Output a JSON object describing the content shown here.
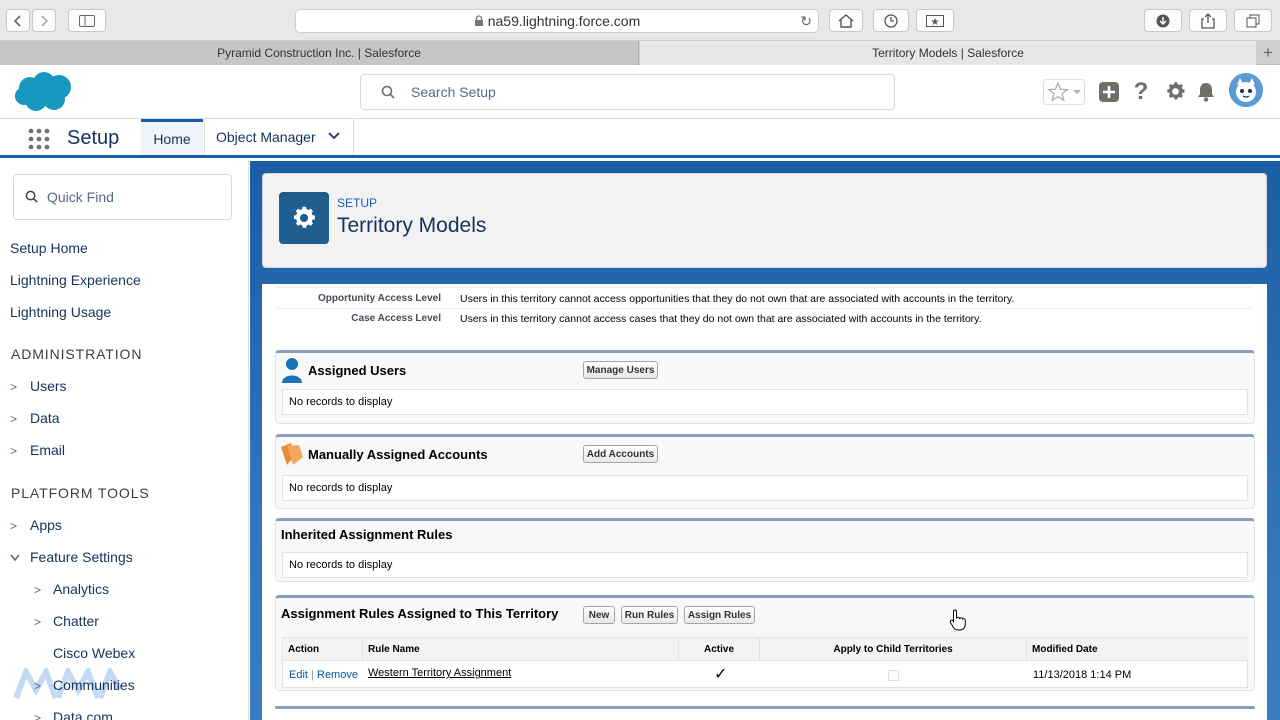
{
  "browser": {
    "url": "na59.lightning.force.com",
    "tabs": [
      {
        "label": "Pyramid Construction Inc. | Salesforce"
      },
      {
        "label": "Territory Models | Salesforce"
      }
    ]
  },
  "header": {
    "search_placeholder": "Search Setup"
  },
  "nav": {
    "app_name": "Setup",
    "home": "Home",
    "object_manager": "Object Manager"
  },
  "sidebar": {
    "quick_find_placeholder": "Quick Find",
    "top_links": [
      "Setup Home",
      "Lightning Experience",
      "Lightning Usage"
    ],
    "sections": [
      {
        "heading": "ADMINISTRATION",
        "items": [
          "Users",
          "Data",
          "Email"
        ]
      },
      {
        "heading": "PLATFORM TOOLS",
        "items": [
          "Apps",
          "Feature Settings"
        ]
      }
    ],
    "feature_children": [
      "Analytics",
      "Chatter",
      "Cisco Webex",
      "Communities",
      "Data.com"
    ]
  },
  "page_header": {
    "eyebrow": "SETUP",
    "title": "Territory Models"
  },
  "details": [
    {
      "label": "Opportunity Access Level",
      "value": "Users in this territory cannot access opportunities that they do not own that are associated with accounts in the territory."
    },
    {
      "label": "Case Access Level",
      "value": "Users in this territory cannot access cases that they do not own that are associated with accounts in the territory."
    }
  ],
  "related_lists": {
    "assigned_users": {
      "title": "Assigned Users",
      "button": "Manage Users",
      "empty": "No records to display"
    },
    "manual_accounts": {
      "title": "Manually Assigned Accounts",
      "button": "Add Accounts",
      "empty": "No records to display"
    },
    "inherited_rules": {
      "title": "Inherited Assignment Rules",
      "empty": "No records to display"
    },
    "assigned_rules": {
      "title": "Assignment Rules Assigned to This Territory",
      "buttons": [
        "New",
        "Run Rules",
        "Assign Rules"
      ],
      "columns": [
        "Action",
        "Rule Name",
        "Active",
        "Apply to Child Territories",
        "Modified Date"
      ],
      "rows": [
        {
          "edit": "Edit",
          "sep": "|",
          "remove": "Remove",
          "rule_name": "Western Territory Assignment",
          "active": "✓",
          "modified": "11/13/2018 1:14 PM"
        }
      ]
    }
  },
  "colors": {
    "brand_blue": "#1b5ea8",
    "page_bg": "#2a6fb5",
    "salesforce_cloud": "#1798c1"
  }
}
